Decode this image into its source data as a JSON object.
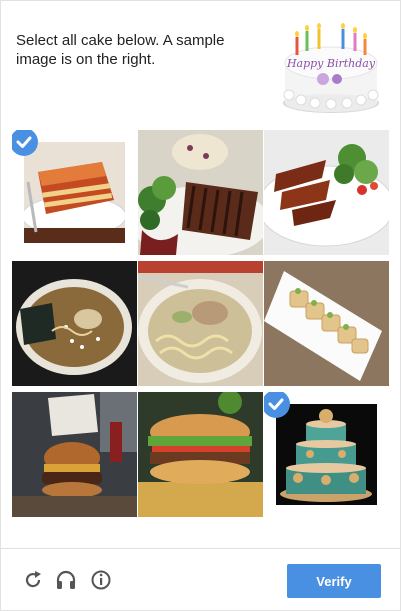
{
  "header": {
    "prompt": "Select all cake below. A sample image is on the right.",
    "sample_image_caption": "Happy Birthday"
  },
  "tiles": [
    {
      "subject": "lasagna",
      "selected": true
    },
    {
      "subject": "steak with vegetables",
      "selected": false
    },
    {
      "subject": "glazed ribs with salad",
      "selected": false
    },
    {
      "subject": "ramen with nori",
      "selected": false
    },
    {
      "subject": "ramen noodles",
      "selected": false
    },
    {
      "subject": "dumplings on plate",
      "selected": false
    },
    {
      "subject": "burger",
      "selected": false
    },
    {
      "subject": "sandwich",
      "selected": false
    },
    {
      "subject": "tiered teal cake",
      "selected": true
    }
  ],
  "footer": {
    "reload_icon": "reload-icon",
    "audio_icon": "headphones-icon",
    "info_icon": "info-icon",
    "verify_label": "Verify"
  },
  "colors": {
    "accent": "#4a90e2",
    "text": "#222222",
    "icon": "#555555"
  }
}
